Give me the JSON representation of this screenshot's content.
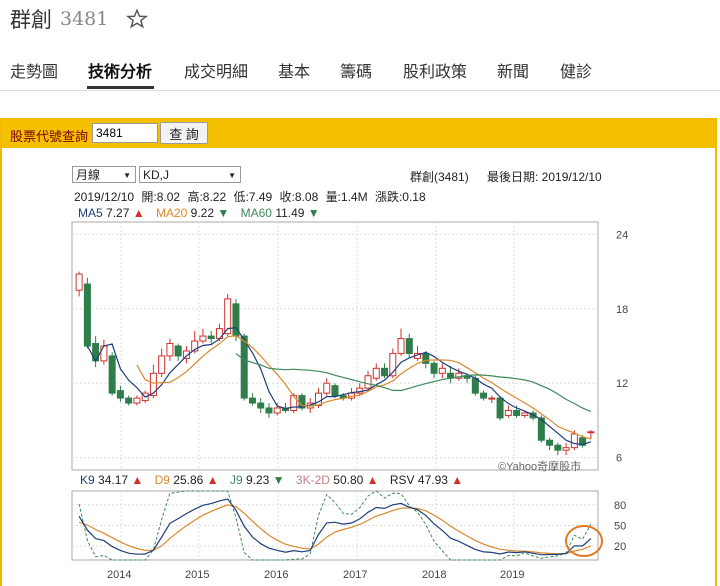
{
  "stock": {
    "name": "群創",
    "code": "3481"
  },
  "tabs": [
    {
      "label": "走勢圖",
      "x": 10
    },
    {
      "label": "技術分析",
      "x": 88,
      "active": true
    },
    {
      "label": "成交明細",
      "x": 184
    },
    {
      "label": "基本",
      "x": 278
    },
    {
      "label": "籌碼",
      "x": 340
    },
    {
      "label": "股利政策",
      "x": 403
    },
    {
      "label": "新聞",
      "x": 497
    },
    {
      "label": "健診",
      "x": 560
    }
  ],
  "query": {
    "label": "股票代號查詢",
    "value": "3481",
    "button": "查 詢"
  },
  "controls": {
    "period": "月線",
    "indicator": "KD,J"
  },
  "header": {
    "name_code": "群創(3481)",
    "last_date": "最後日期: 2019/12/10"
  },
  "quote": {
    "date": "2019/12/10",
    "open": "開:8.02",
    "high": "高:8.22",
    "low": "低:7.49",
    "close": "收:8.08",
    "volume": "量:1.4M",
    "change": "漲跌:0.18"
  },
  "ma": {
    "ma5": {
      "label": "MA5",
      "value": "7.27",
      "dir": "up"
    },
    "ma20": {
      "label": "MA20",
      "value": "9.22",
      "dir": "down"
    },
    "ma60": {
      "label": "MA60",
      "value": "11.49",
      "dir": "down"
    }
  },
  "kd": {
    "k": {
      "label": "K9",
      "value": "34.17",
      "dir": "up"
    },
    "d": {
      "label": "D9",
      "value": "25.86",
      "dir": "up"
    },
    "j": {
      "label": "J9",
      "value": "9.23",
      "dir": "down"
    },
    "diff": {
      "label": "3K-2D",
      "value": "50.80",
      "dir": "up"
    },
    "rsv": {
      "label": "RSV",
      "value": "47.93",
      "dir": "up"
    }
  },
  "watermark": "©Yahoo奇摩股市",
  "colors": {
    "up": "#d0312d",
    "down": "#2e7d4a",
    "ma5": "#1f3f7a",
    "ma20": "#d9892b",
    "ma60": "#3f8a5a",
    "highlight": "#e07b20",
    "panel": "#f5c000"
  },
  "chart_data": {
    "type": "candlestick",
    "y_ticks": [
      "24",
      "18",
      "12",
      "6"
    ],
    "kd_ticks": [
      "80",
      "50",
      "20"
    ],
    "x_ticks": [
      "2014",
      "2015",
      "2016",
      "2017",
      "2018",
      "2019"
    ],
    "candles": [
      {
        "o": 19.5,
        "c": 20.8,
        "h": 21.0,
        "l": 19.0
      },
      {
        "o": 20.0,
        "c": 15.0,
        "h": 20.5,
        "l": 14.8
      },
      {
        "o": 15.2,
        "c": 13.8,
        "h": 15.8,
        "l": 13.3
      },
      {
        "o": 13.8,
        "c": 15.0,
        "h": 15.5,
        "l": 13.5
      },
      {
        "o": 14.2,
        "c": 11.2,
        "h": 14.5,
        "l": 11.0
      },
      {
        "o": 11.4,
        "c": 10.8,
        "h": 11.8,
        "l": 10.5
      },
      {
        "o": 10.8,
        "c": 10.4,
        "h": 11.0,
        "l": 10.2
      },
      {
        "o": 10.4,
        "c": 10.8,
        "h": 11.0,
        "l": 10.2
      },
      {
        "o": 10.6,
        "c": 11.2,
        "h": 11.4,
        "l": 10.4
      },
      {
        "o": 11.0,
        "c": 12.8,
        "h": 13.5,
        "l": 10.8
      },
      {
        "o": 12.8,
        "c": 14.2,
        "h": 14.8,
        "l": 12.5
      },
      {
        "o": 14.2,
        "c": 15.2,
        "h": 15.6,
        "l": 13.8
      },
      {
        "o": 15.0,
        "c": 14.2,
        "h": 15.2,
        "l": 13.8
      },
      {
        "o": 14.0,
        "c": 14.6,
        "h": 15.0,
        "l": 13.6
      },
      {
        "o": 14.6,
        "c": 15.4,
        "h": 16.2,
        "l": 14.4
      },
      {
        "o": 15.4,
        "c": 15.8,
        "h": 16.4,
        "l": 15.2
      },
      {
        "o": 15.8,
        "c": 15.6,
        "h": 16.2,
        "l": 15.2
      },
      {
        "o": 15.6,
        "c": 16.4,
        "h": 16.8,
        "l": 15.4
      },
      {
        "o": 16.0,
        "c": 18.8,
        "h": 19.2,
        "l": 15.8
      },
      {
        "o": 18.4,
        "c": 15.8,
        "h": 18.8,
        "l": 15.4
      },
      {
        "o": 15.8,
        "c": 10.8,
        "h": 16.0,
        "l": 10.6
      },
      {
        "o": 10.8,
        "c": 10.4,
        "h": 11.2,
        "l": 10.2
      },
      {
        "o": 10.4,
        "c": 10.0,
        "h": 10.8,
        "l": 9.6
      },
      {
        "o": 10.0,
        "c": 9.6,
        "h": 10.4,
        "l": 9.2
      },
      {
        "o": 9.6,
        "c": 10.0,
        "h": 10.4,
        "l": 9.4
      },
      {
        "o": 10.0,
        "c": 9.8,
        "h": 10.4,
        "l": 9.6
      },
      {
        "o": 9.8,
        "c": 11.0,
        "h": 11.2,
        "l": 9.6
      },
      {
        "o": 11.0,
        "c": 10.0,
        "h": 11.2,
        "l": 9.8
      },
      {
        "o": 10.0,
        "c": 10.4,
        "h": 10.8,
        "l": 9.6
      },
      {
        "o": 10.2,
        "c": 11.2,
        "h": 11.6,
        "l": 10.0
      },
      {
        "o": 11.2,
        "c": 12.0,
        "h": 12.4,
        "l": 11.0
      },
      {
        "o": 11.8,
        "c": 11.0,
        "h": 12.0,
        "l": 10.8
      },
      {
        "o": 11.0,
        "c": 10.8,
        "h": 11.2,
        "l": 10.6
      },
      {
        "o": 10.8,
        "c": 11.2,
        "h": 11.6,
        "l": 10.6
      },
      {
        "o": 11.2,
        "c": 11.6,
        "h": 12.0,
        "l": 11.0
      },
      {
        "o": 11.6,
        "c": 12.6,
        "h": 13.0,
        "l": 11.4
      },
      {
        "o": 12.4,
        "c": 13.2,
        "h": 13.6,
        "l": 12.2
      },
      {
        "o": 13.2,
        "c": 12.6,
        "h": 13.6,
        "l": 12.4
      },
      {
        "o": 12.6,
        "c": 14.4,
        "h": 14.8,
        "l": 12.4
      },
      {
        "o": 14.4,
        "c": 15.6,
        "h": 16.4,
        "l": 14.2
      },
      {
        "o": 15.6,
        "c": 14.4,
        "h": 16.0,
        "l": 14.0
      },
      {
        "o": 14.0,
        "c": 14.4,
        "h": 15.0,
        "l": 13.8
      },
      {
        "o": 14.4,
        "c": 13.6,
        "h": 14.6,
        "l": 13.2
      },
      {
        "o": 13.6,
        "c": 12.8,
        "h": 13.8,
        "l": 12.4
      },
      {
        "o": 12.8,
        "c": 13.2,
        "h": 13.6,
        "l": 12.4
      },
      {
        "o": 12.8,
        "c": 12.4,
        "h": 13.4,
        "l": 12.0
      },
      {
        "o": 12.4,
        "c": 12.8,
        "h": 13.2,
        "l": 12.2
      },
      {
        "o": 12.6,
        "c": 12.4,
        "h": 12.8,
        "l": 12.0
      },
      {
        "o": 12.4,
        "c": 11.2,
        "h": 12.6,
        "l": 11.0
      },
      {
        "o": 11.2,
        "c": 10.8,
        "h": 11.4,
        "l": 10.6
      },
      {
        "o": 10.8,
        "c": 10.8,
        "h": 11.0,
        "l": 10.4
      },
      {
        "o": 10.8,
        "c": 9.2,
        "h": 11.0,
        "l": 9.0
      },
      {
        "o": 9.4,
        "c": 9.8,
        "h": 10.2,
        "l": 9.2
      },
      {
        "o": 9.8,
        "c": 9.4,
        "h": 10.2,
        "l": 9.2
      },
      {
        "o": 9.4,
        "c": 9.6,
        "h": 9.8,
        "l": 9.2
      },
      {
        "o": 9.6,
        "c": 9.2,
        "h": 9.8,
        "l": 9.0
      },
      {
        "o": 9.2,
        "c": 7.4,
        "h": 9.4,
        "l": 7.2
      },
      {
        "o": 7.4,
        "c": 7.0,
        "h": 7.6,
        "l": 6.6
      },
      {
        "o": 7.0,
        "c": 6.6,
        "h": 7.2,
        "l": 6.2
      },
      {
        "o": 6.6,
        "c": 6.8,
        "h": 7.2,
        "l": 6.2
      },
      {
        "o": 6.8,
        "c": 7.9,
        "h": 8.2,
        "l": 6.6
      },
      {
        "o": 7.6,
        "c": 7.0,
        "h": 7.8,
        "l": 6.8
      },
      {
        "o": 8.02,
        "c": 8.08,
        "h": 8.22,
        "l": 7.49
      }
    ]
  }
}
